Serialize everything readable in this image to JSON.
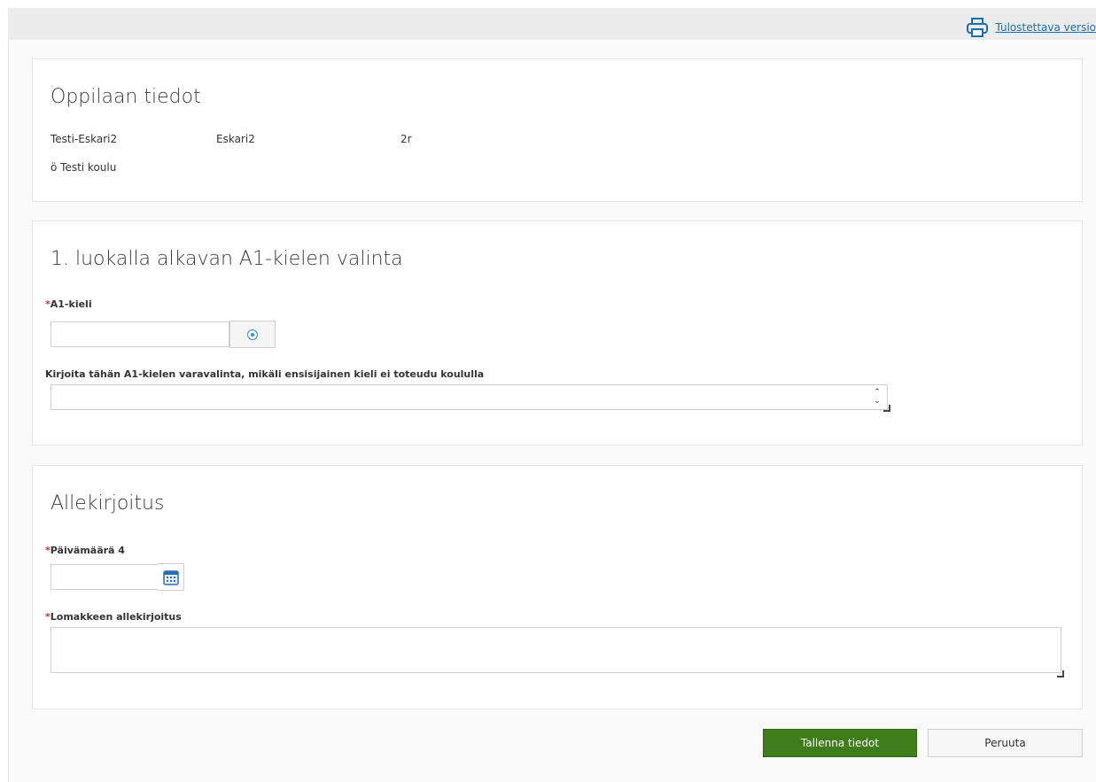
{
  "toolbar": {
    "print_label": "Tulostettava versio"
  },
  "student": {
    "title": "Oppilaan tiedot",
    "last_name": "Testi-Eskari2",
    "first_name": "Eskari2",
    "class": "2r",
    "school": "ö Testi koulu"
  },
  "language": {
    "title": "1. luokalla alkavan A1-kielen valinta",
    "a1_label": "A1-kieli",
    "a1_value": "",
    "backup_label": "Kirjoita tähän A1-kielen varavalinta, mikäli ensisijainen kieli ei toteudu koululla",
    "backup_value": ""
  },
  "signature": {
    "title": "Allekirjoitus",
    "date_label": "Päivämäärä 4",
    "date_value": "",
    "sign_label": "Lomakkeen allekirjoitus",
    "sign_value": ""
  },
  "required_mark": "*",
  "actions": {
    "save": "Tallenna tiedot",
    "cancel": "Peruuta"
  },
  "colors": {
    "primary": "#3e7d1a",
    "link": "#1a6fb3",
    "required": "#d32f2f"
  }
}
